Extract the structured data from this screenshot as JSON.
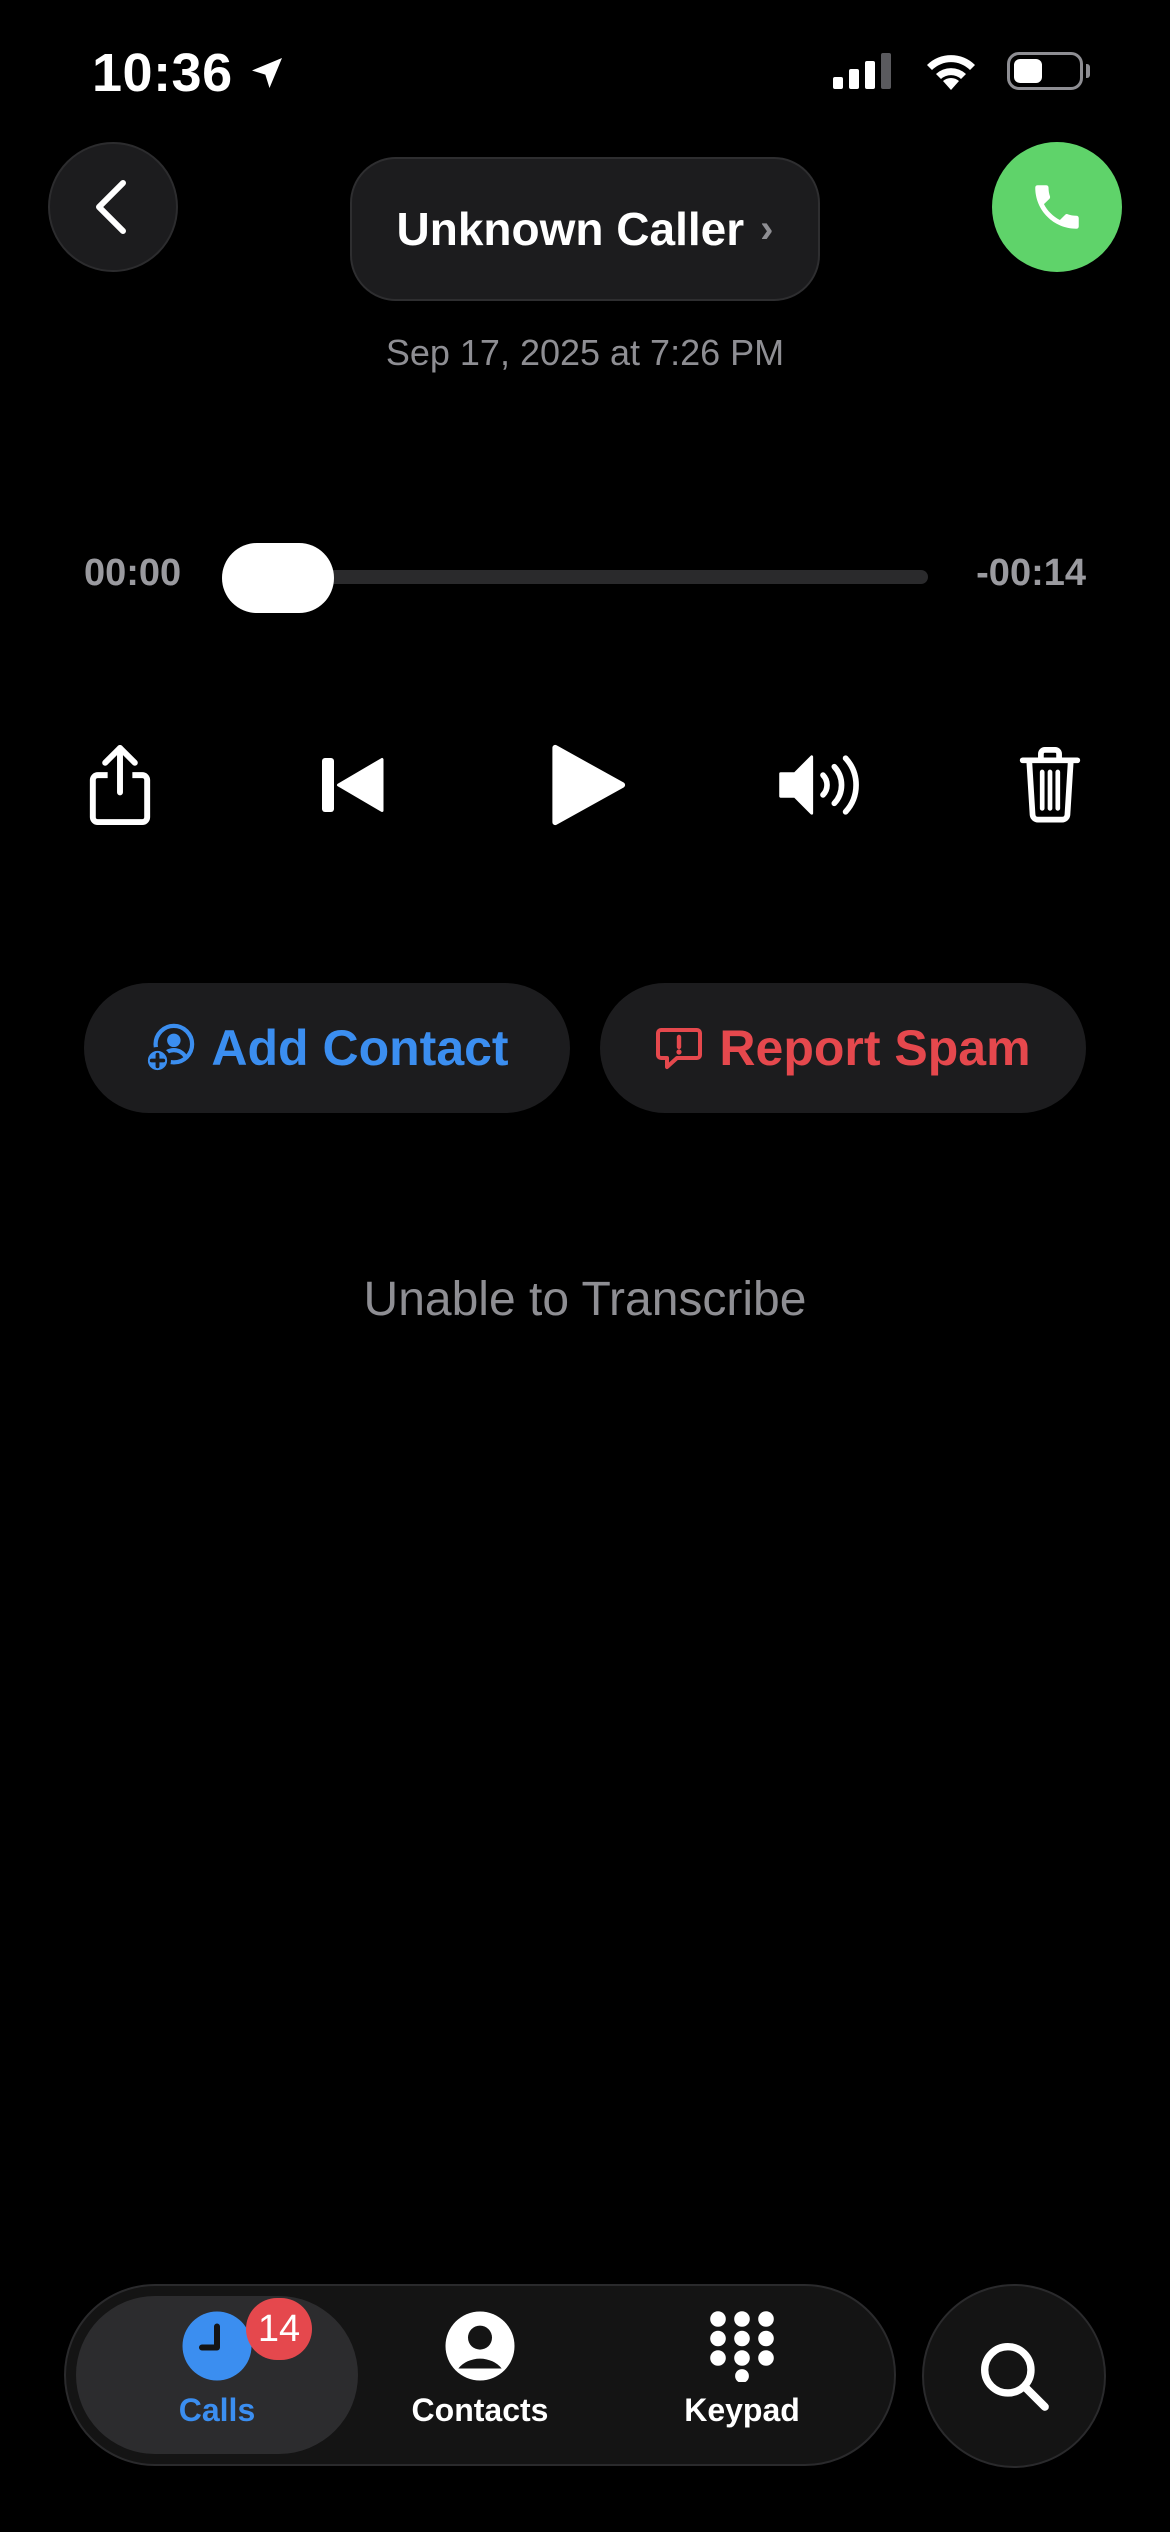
{
  "status_bar": {
    "time": "10:36",
    "icons": [
      "location-arrow-icon",
      "cellular-signal-icon",
      "wifi-icon",
      "battery-icon"
    ],
    "battery_level": 0.45
  },
  "header": {
    "back_icon": "chevron-left-icon",
    "caller_name": "Unknown Caller",
    "caller_chevron": "›",
    "call_icon": "phone-icon",
    "date": "Sep 17, 2025 at 7:26 PM"
  },
  "playback": {
    "elapsed": "00:00",
    "remaining": "-00:14",
    "progress": 0.0
  },
  "controls": [
    "share-icon",
    "skip-back-icon",
    "play-icon",
    "speaker-icon",
    "trash-icon"
  ],
  "actions": {
    "add_contact": "Add Contact",
    "report_spam": "Report Spam"
  },
  "transcription": "Unable to Transcribe",
  "colors": {
    "accent_blue": "#3b8ef0",
    "spam_red": "#e5484d",
    "call_green": "#5fd36a"
  },
  "tabbar": {
    "tabs": [
      {
        "label": "Calls",
        "icon": "clock-icon",
        "active": true,
        "badge": "14"
      },
      {
        "label": "Contacts",
        "icon": "person-circle-icon",
        "active": false
      },
      {
        "label": "Keypad",
        "icon": "keypad-icon",
        "active": false
      }
    ],
    "search_icon": "search-icon"
  }
}
